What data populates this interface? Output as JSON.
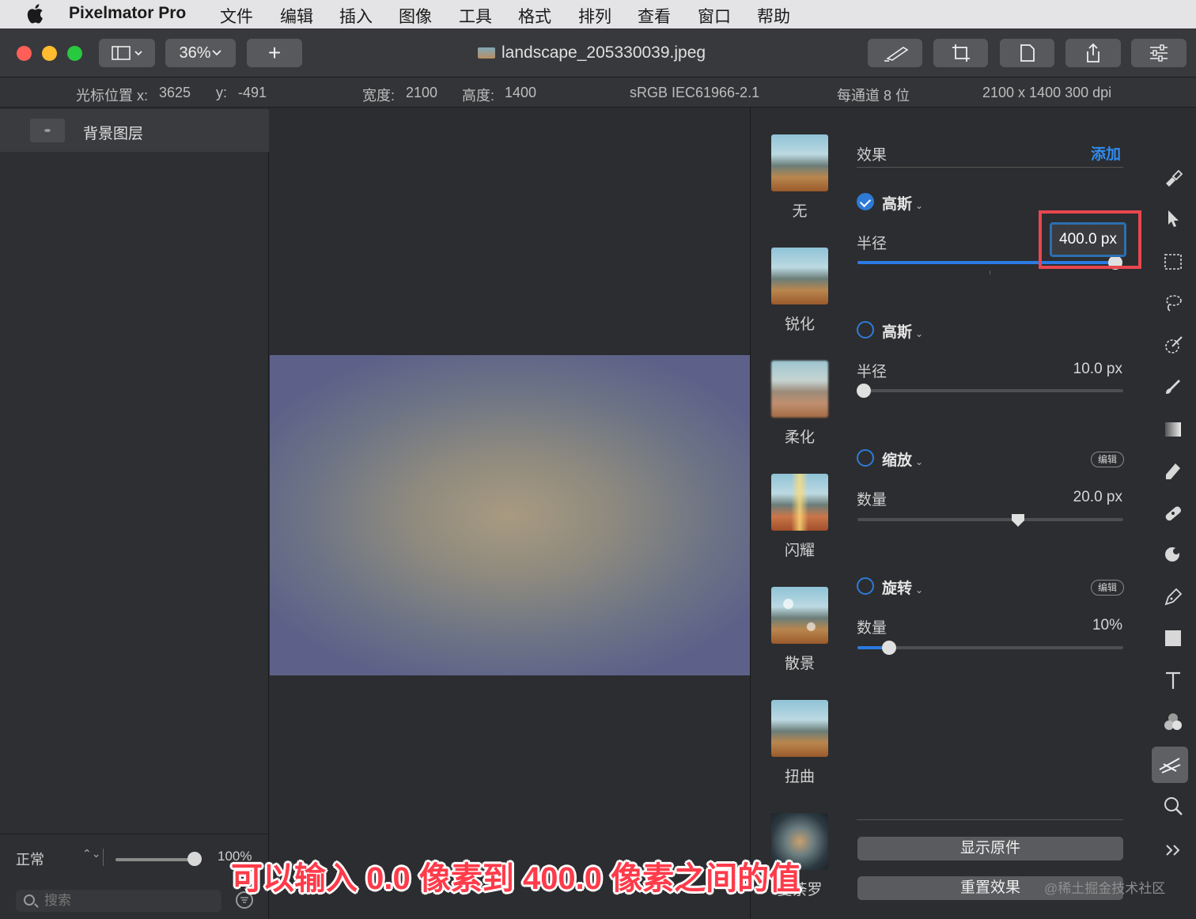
{
  "menubar": {
    "app_name": "Pixelmator Pro",
    "items": [
      "文件",
      "编辑",
      "插入",
      "图像",
      "工具",
      "格式",
      "排列",
      "查看",
      "窗口",
      "帮助"
    ]
  },
  "toolbar": {
    "zoom": "36%",
    "add_label": "+",
    "document_title": "landscape_205330039.jpeg"
  },
  "infobar": {
    "cursor_x_label": "光标位置 x:",
    "cursor_x": "3625",
    "cursor_y_label": "y:",
    "cursor_y": "-491",
    "width_label": "宽度:",
    "width": "2100",
    "height_label": "高度:",
    "height": "1400",
    "color_profile": "sRGB IEC61966-2.1",
    "bit_depth": "每通道 8 位",
    "dimensions": "2100 x 1400 300 dpi"
  },
  "layers": {
    "items": [
      {
        "name": "背景图层"
      }
    ],
    "blend_mode": "正常",
    "opacity": "100%",
    "opacity_fraction": 1.0,
    "search_placeholder": "搜索"
  },
  "effects": {
    "header": "效果",
    "add_label": "添加",
    "presets": [
      "无",
      "锐化",
      "柔化",
      "闪耀",
      "散景",
      "扭曲",
      "曼荼罗"
    ],
    "list": [
      {
        "name": "高斯",
        "enabled": true,
        "param": "半径",
        "value": "400.0 px",
        "fraction": 1.0
      },
      {
        "name": "高斯",
        "enabled": false,
        "param": "半径",
        "value": "10.0 px",
        "fraction": 0.025
      },
      {
        "name": "缩放",
        "enabled": false,
        "param": "数量",
        "value": "20.0 px",
        "fraction": 0.6,
        "edit_label": "编辑"
      },
      {
        "name": "旋转",
        "enabled": false,
        "param": "数量",
        "value": "10%",
        "fraction": 0.12,
        "edit_label": "编辑"
      }
    ],
    "show_original": "显示原件",
    "reset_effects": "重置效果"
  },
  "tools": [
    "paint-icon",
    "arrow-select-icon",
    "rect-select-icon",
    "lasso-icon",
    "magic-wand-icon",
    "brush-icon",
    "gradient-icon",
    "eraser-icon",
    "bandage-icon",
    "sponge-icon",
    "pen-icon",
    "shape-icon",
    "text-icon",
    "color-adjust-icon",
    "effects-icon",
    "zoom-icon",
    "more-icon"
  ],
  "colors": {
    "accent": "#2a7be4",
    "highlight_box": "#e8474f",
    "caption": "#ff3b4a"
  },
  "overlay": {
    "caption": "可以输入 0.0 像素到 400.0 像素之间的值",
    "watermark": "@稀土掘金技术社区"
  }
}
